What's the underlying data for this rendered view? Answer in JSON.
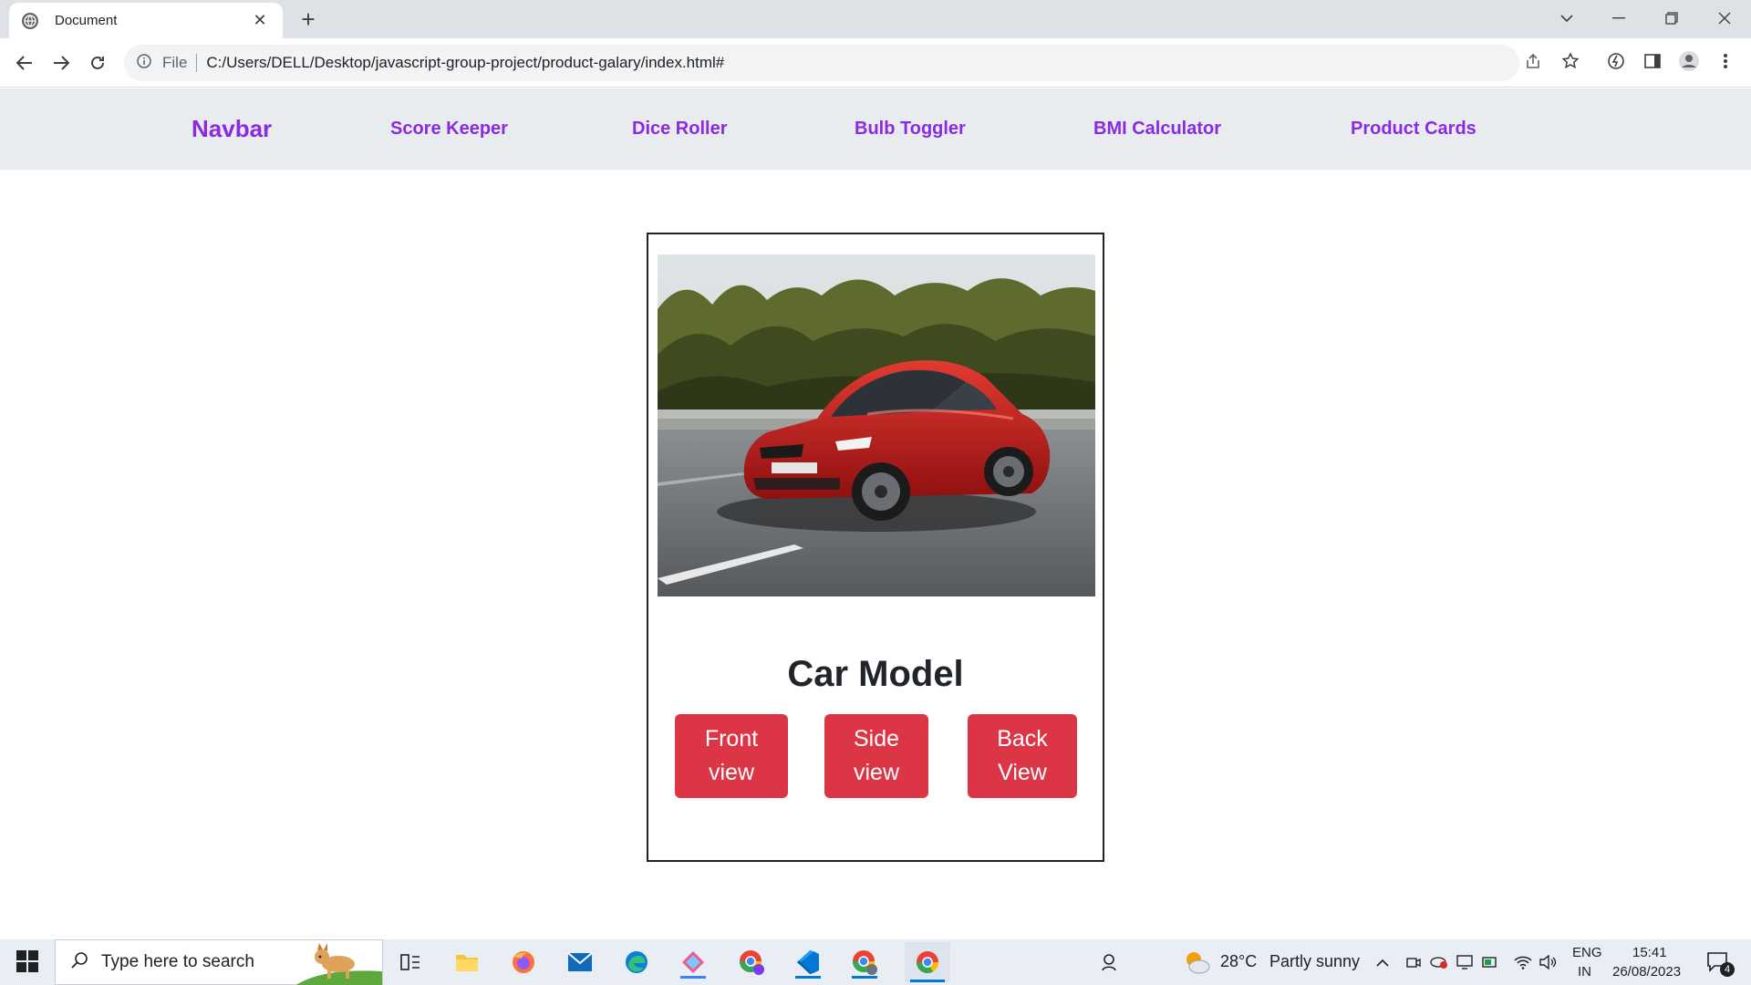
{
  "browser": {
    "tab_title": "Document",
    "new_tab_symbol": "+",
    "close_symbol": "✕",
    "omnibox_scheme": "File",
    "omnibox_url": "C:/Users/DELL/Desktop/javascript-group-project/product-galary/index.html#"
  },
  "navbar": {
    "brand": "Navbar",
    "links": [
      "Score Keeper",
      "Dice Roller",
      "Bulb Toggler",
      "BMI Calculator",
      "Product Cards"
    ],
    "link_color": "#8a2be2"
  },
  "card": {
    "image_alt": "red-sports-car",
    "title": "Car Model",
    "buttons": [
      {
        "line1": "Front",
        "line2": "view"
      },
      {
        "line1": "Side",
        "line2": "view"
      },
      {
        "line1": "Back",
        "line2": "View"
      }
    ],
    "button_color": "#dc3545"
  },
  "taskbar": {
    "search_placeholder": "Type here to search",
    "weather_temp": "28°C",
    "weather_text": "Partly sunny",
    "lang_top": "ENG",
    "lang_bottom": "IN",
    "time": "15:41",
    "date": "26/08/2023",
    "notification_count": "4",
    "apps": [
      "task-view-icon",
      "file-explorer-icon",
      "firefox-icon",
      "mail-icon",
      "edge-icon",
      "app-icon",
      "chrome-profile-icon",
      "vscode-icon",
      "chrome-profile-icon-2",
      "chrome-icon"
    ]
  }
}
